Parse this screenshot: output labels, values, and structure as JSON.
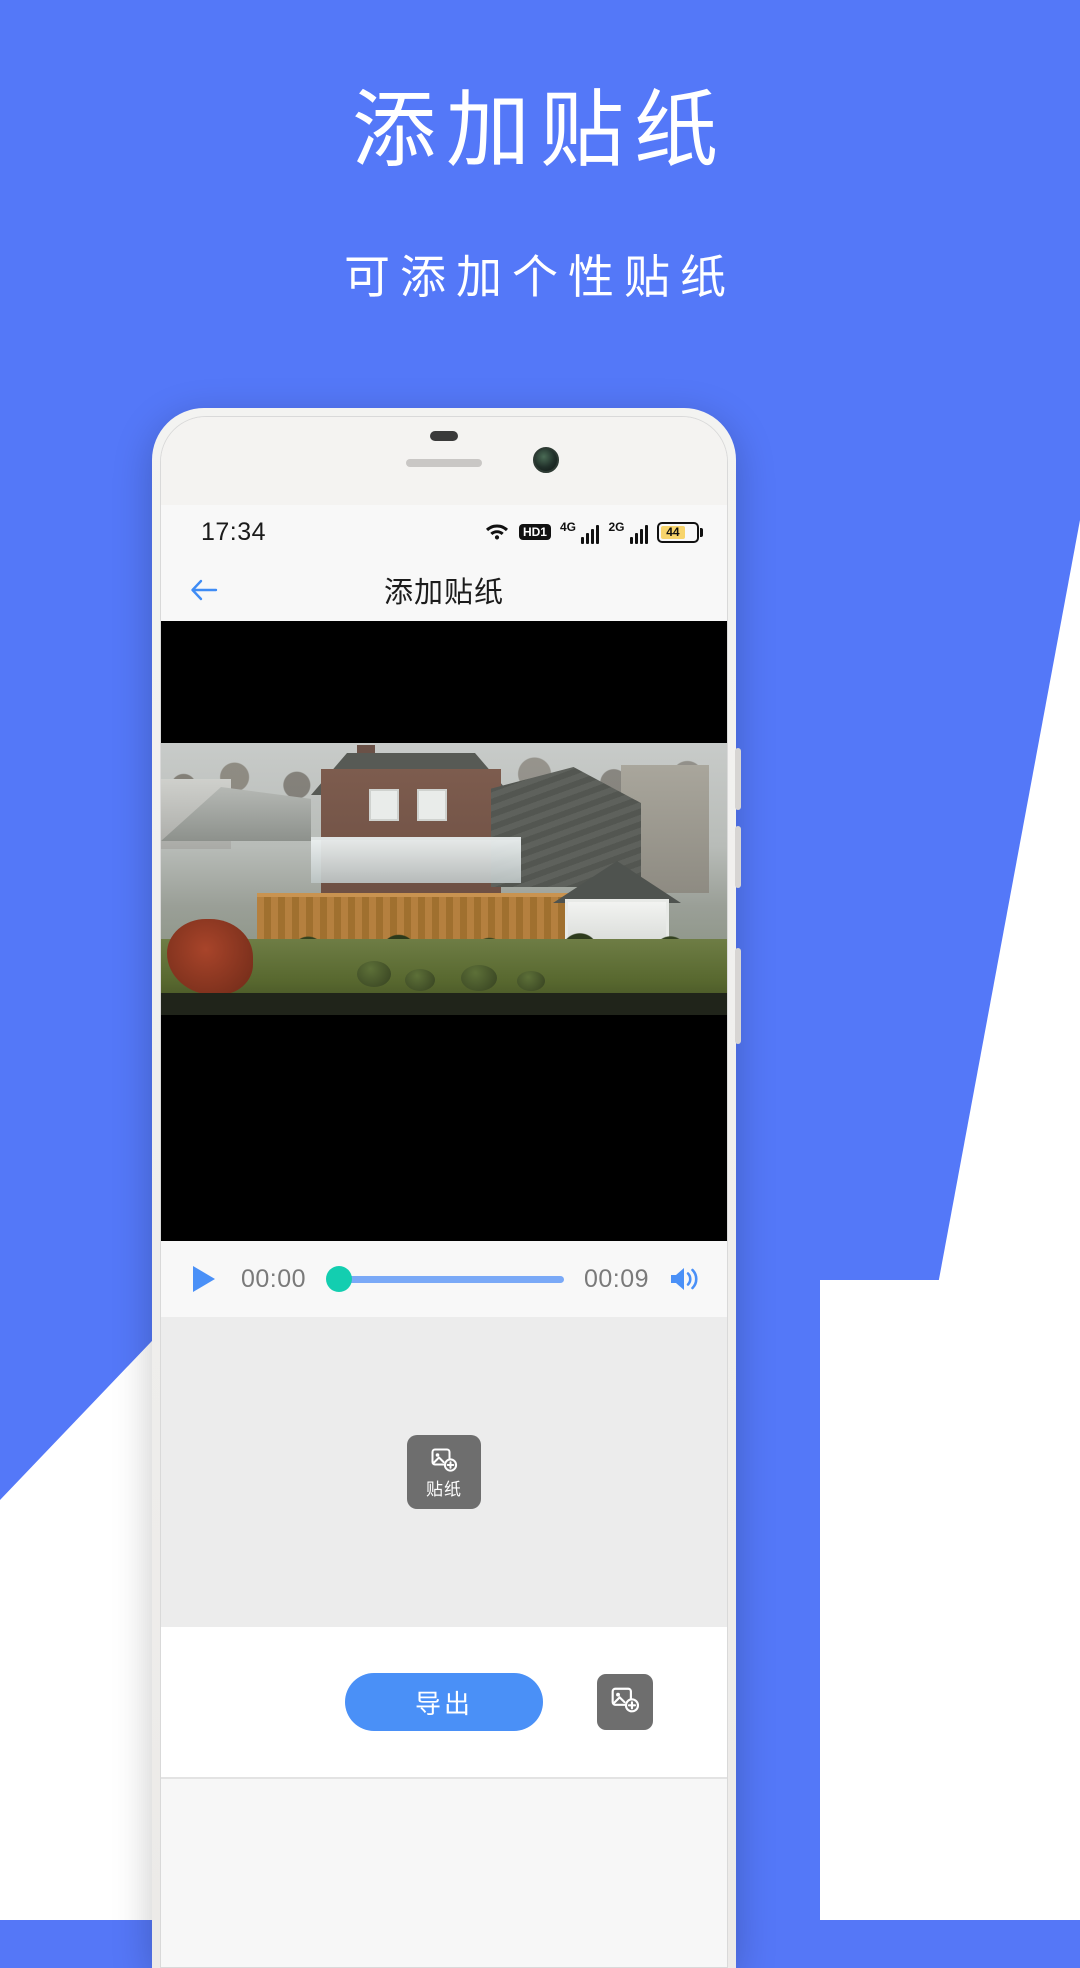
{
  "theme": {
    "background_blue": "#5478f8",
    "accent_blue": "#4a90f7",
    "seek_handle_teal": "#13ceb0",
    "seek_track_blue": "#7aa9f7",
    "tool_gray": "#6e6e6e",
    "panel_gray": "#ececec",
    "battery_yellow": "#f7d46b"
  },
  "promo": {
    "title": "添加贴纸",
    "subtitle": "可添加个性贴纸"
  },
  "phone": {
    "status_bar": {
      "time": "17:34",
      "wifi_icon": "wifi-icon",
      "hd_badge": "HD1",
      "signal_1_label": "4G",
      "signal_2_label": "2G",
      "battery_level": "44"
    },
    "nav_bar": {
      "back_icon": "back-arrow-icon",
      "title": "添加贴纸"
    },
    "player": {
      "play_icon": "play-icon",
      "time_current": "00:00",
      "time_total": "00:09",
      "volume_icon": "volume-icon",
      "progress_percent": 0
    },
    "editor": {
      "sticker_tool_icon": "sticker-icon",
      "sticker_tool_label": "贴纸"
    },
    "bottom": {
      "export_label": "导出",
      "sticker_button_icon": "sticker-icon"
    }
  }
}
